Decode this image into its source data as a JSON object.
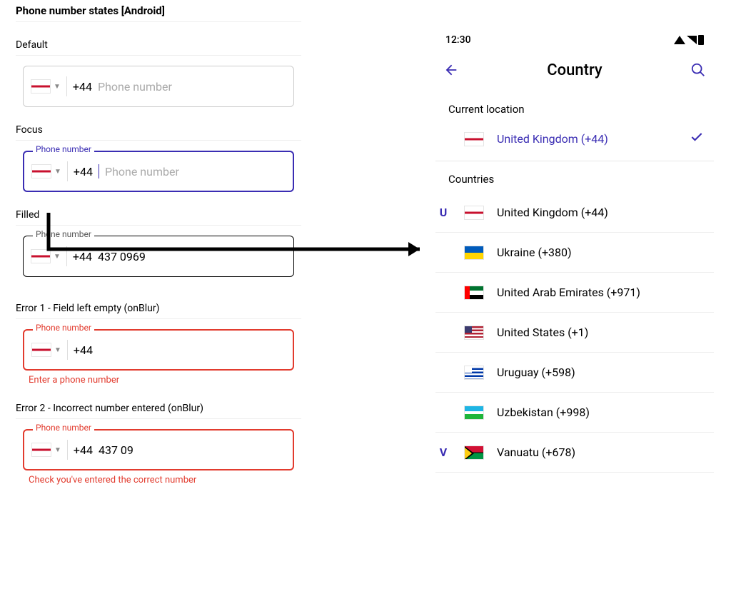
{
  "page_title": "Phone number states [Android]",
  "states": {
    "default": {
      "label": "Default",
      "prefix": "+44",
      "placeholder": "Phone number"
    },
    "focus": {
      "label": "Focus",
      "float_label": "Phone number",
      "prefix": "+44",
      "placeholder": "Phone number"
    },
    "filled": {
      "label": "Filled",
      "float_label": "Phone number",
      "prefix": "+44",
      "value": "437 0969"
    },
    "error1": {
      "label": "Error 1 - Field left empty (onBlur)",
      "float_label": "Phone number",
      "prefix": "+44",
      "helper": "Enter a phone number"
    },
    "error2": {
      "label": "Error 2 - Incorrect number entered (onBlur)",
      "float_label": "Phone number",
      "prefix": "+44",
      "value": "437 09",
      "helper": "Check you've entered the correct number"
    }
  },
  "country_picker": {
    "status_time": "12:30",
    "title": "Country",
    "current_location_header": "Current location",
    "current": {
      "name": "United Kingdom (+44)",
      "flag": "uk"
    },
    "countries_header": "Countries",
    "list": [
      {
        "letter": "U",
        "name": "United Kingdom (+44)",
        "flag": "uk"
      },
      {
        "letter": "",
        "name": "Ukraine (+380)",
        "flag": "ua"
      },
      {
        "letter": "",
        "name": "United Arab Emirates (+971)",
        "flag": "ae"
      },
      {
        "letter": "",
        "name": "United States (+1)",
        "flag": "us"
      },
      {
        "letter": "",
        "name": "Uruguay (+598)",
        "flag": "uy"
      },
      {
        "letter": "",
        "name": "Uzbekistan (+998)",
        "flag": "uz"
      },
      {
        "letter": "V",
        "name": "Vanuatu (+678)",
        "flag": "vu"
      }
    ]
  },
  "colors": {
    "accent": "#3a2db3",
    "error": "#e23b2e"
  }
}
